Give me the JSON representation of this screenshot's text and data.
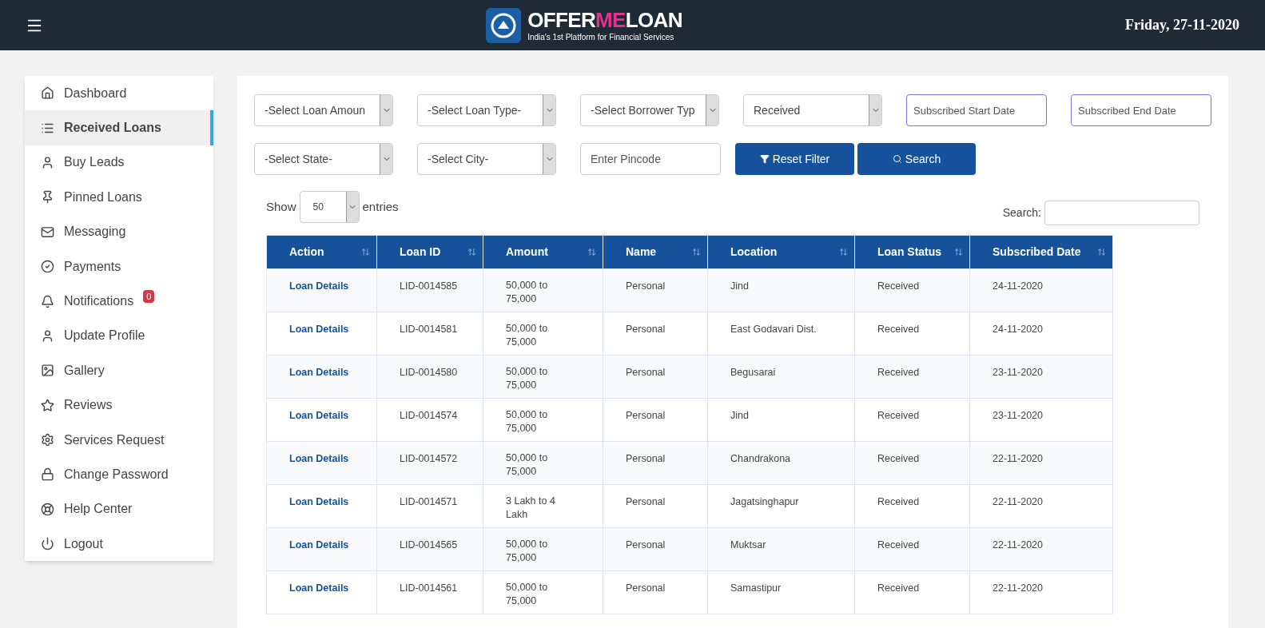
{
  "header": {
    "brand_start": "OFFER",
    "brand_highlight": "ME",
    "brand_end": "LOAN",
    "tagline": "India's 1st Platform for Financial Services",
    "date": "Friday, 27-11-2020"
  },
  "sidebar": {
    "items": [
      {
        "label": "Dashboard",
        "selected": false
      },
      {
        "label": "Received Loans",
        "selected": true
      },
      {
        "label": "Buy Leads",
        "selected": false
      },
      {
        "label": "Pinned Loans",
        "selected": false
      },
      {
        "label": "Messaging",
        "selected": false
      },
      {
        "label": "Payments",
        "selected": false
      },
      {
        "label": "Notifications",
        "selected": false,
        "badge": "0"
      },
      {
        "label": "Update Profile",
        "selected": false
      },
      {
        "label": "Gallery",
        "selected": false
      },
      {
        "label": "Reviews",
        "selected": false
      },
      {
        "label": "Services Request",
        "selected": false
      },
      {
        "label": "Change Password",
        "selected": false
      },
      {
        "label": "Help Center",
        "selected": false
      },
      {
        "label": "Logout",
        "selected": false
      }
    ]
  },
  "filters": [
    {
      "kind": "select",
      "value": "-Select Loan Amoun"
    },
    {
      "kind": "select",
      "value": "-Select Loan Type-"
    },
    {
      "kind": "select",
      "value": "-Select Borrower Typ"
    },
    {
      "kind": "select",
      "value": "Received"
    },
    {
      "kind": "date",
      "placeholder": "Subscribed Start Date"
    },
    {
      "kind": "date",
      "placeholder": "Subscribed End Date"
    },
    {
      "kind": "select",
      "value": "-Select State-"
    },
    {
      "kind": "select",
      "value": "-Select City-"
    },
    {
      "kind": "text",
      "placeholder": "Enter Pincode"
    },
    {
      "kind": "reset",
      "label": "Reset Filter"
    },
    {
      "kind": "search",
      "label": "Search"
    }
  ],
  "table_controls": {
    "show_label": "Show",
    "page_size": "50",
    "entries_label": "entries",
    "search_label": "Search:"
  },
  "table": {
    "columns": [
      "Action",
      "Loan ID",
      "Amount",
      "Name",
      "Location",
      "Loan Status",
      "Subscribed Date"
    ],
    "rows": [
      [
        "Loan Details",
        "LID-0014585",
        "50,000 to 75,000",
        "Personal",
        "Jind",
        "Received",
        "24-11-2020"
      ],
      [
        "Loan Details",
        "LID-0014581",
        "50,000 to 75,000",
        "Personal",
        "East Godavari Dist.",
        "Received",
        "24-11-2020"
      ],
      [
        "Loan Details",
        "LID-0014580",
        "50,000 to 75,000",
        "Personal",
        "Begusarai",
        "Received",
        "23-11-2020"
      ],
      [
        "Loan Details",
        "LID-0014574",
        "50,000 to 75,000",
        "Personal",
        "Jind",
        "Received",
        "23-11-2020"
      ],
      [
        "Loan Details",
        "LID-0014572",
        "50,000 to 75,000",
        "Personal",
        "Chandrakona",
        "Received",
        "22-11-2020"
      ],
      [
        "Loan Details",
        "LID-0014571",
        "3 Lakh to 4 Lakh",
        "Personal",
        "Jagatsinghapur",
        "Received",
        "22-11-2020"
      ],
      [
        "Loan Details",
        "LID-0014565",
        "50,000 to 75,000",
        "Personal",
        "Muktsar",
        "Received",
        "22-11-2020"
      ],
      [
        "Loan Details",
        "LID-0014561",
        "50,000 to 75,000",
        "Personal",
        "Samastipur",
        "Received",
        "22-11-2020"
      ]
    ]
  }
}
